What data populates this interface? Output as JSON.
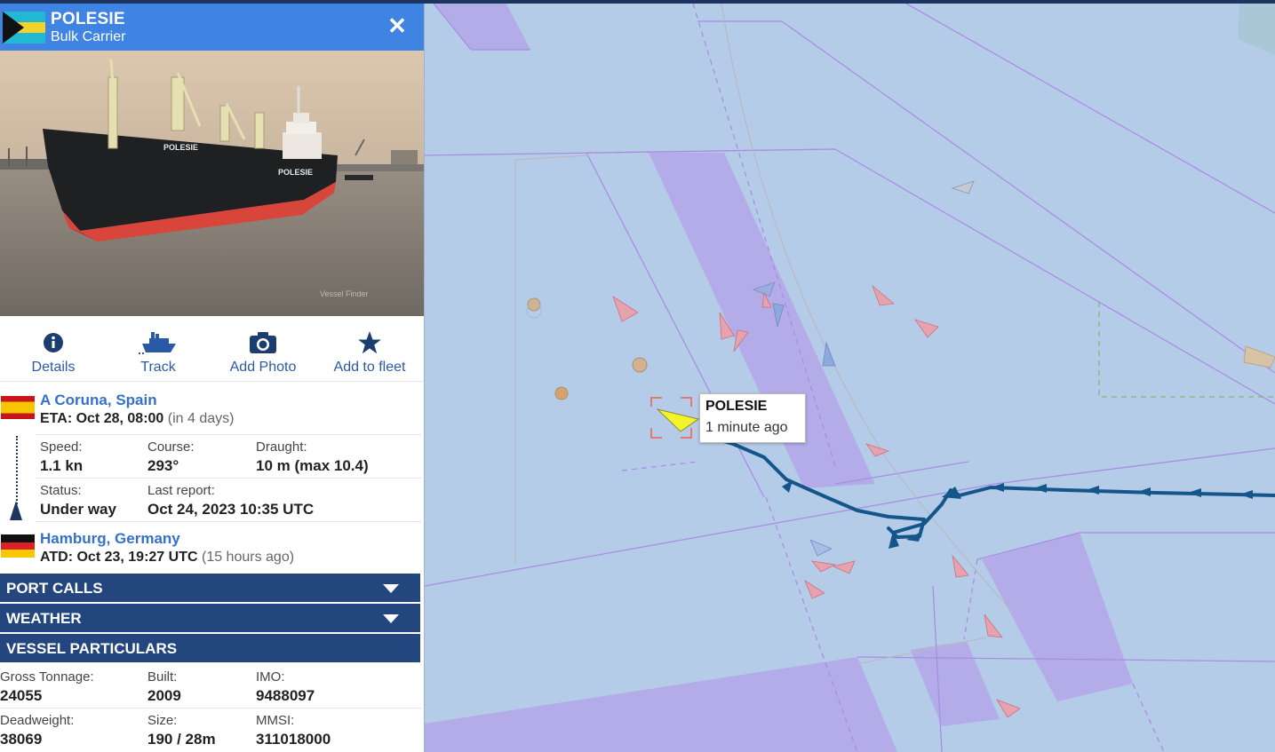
{
  "vessel": {
    "name": "POLESIE",
    "type": "Bulk Carrier",
    "flag_icon": "bahamas-flag",
    "close_icon": "close-icon",
    "hull_name": "POLESIE",
    "hull_name_side": "POLESIE",
    "photo_watermark": "Vessel Finder"
  },
  "actions": [
    {
      "label": "Details",
      "icon": "info-icon"
    },
    {
      "label": "Track",
      "icon": "ship-icon"
    },
    {
      "label": "Add Photo",
      "icon": "camera-icon"
    },
    {
      "label": "Add to fleet",
      "icon": "star-icon"
    }
  ],
  "destination": {
    "port": "A Coruna, Spain",
    "flag_icon": "spain-flag",
    "eta_label": "ETA: Oct 28, 08:00",
    "eta_note": "(in 4 days)"
  },
  "voyage": {
    "speed_label": "Speed:",
    "speed": "1.1 kn",
    "course_label": "Course:",
    "course": "293°",
    "draught_label": "Draught:",
    "draught": "10 m (max 10.4)",
    "status_label": "Status:",
    "status": "Under way",
    "last_report_label": "Last report:",
    "last_report": "Oct 24, 2023 10:35 UTC"
  },
  "departure": {
    "port": "Hamburg, Germany",
    "flag_icon": "germany-flag",
    "atd_label": "ATD: Oct 23, 19:27 UTC",
    "atd_note": "(15 hours ago)"
  },
  "sections": {
    "port_calls": "PORT CALLS",
    "weather": "WEATHER",
    "vessel_particulars": "VESSEL PARTICULARS"
  },
  "particulars": {
    "gross_tonnage_label": "Gross Tonnage:",
    "gross_tonnage": "24055",
    "built_label": "Built:",
    "built": "2009",
    "imo_label": "IMO:",
    "imo": "9488097",
    "deadweight_label": "Deadweight:",
    "deadweight": "38069",
    "size_label": "Size:",
    "size": "190 / 28m",
    "mmsi_label": "MMSI:",
    "mmsi": "311018000"
  },
  "map": {
    "tooltip_name": "POLESIE",
    "tooltip_time": "1 minute ago",
    "colors": {
      "water": "#b5cce8",
      "lane": "#b3a9e8",
      "lane_edge": "#a98de3",
      "track": "#14568a",
      "selected_vessel": "#f3f22b",
      "selection_box": "#e27a72",
      "other_vessel_cargo": "#e6a2ae",
      "other_vessel_blue": "#8da9de"
    }
  }
}
